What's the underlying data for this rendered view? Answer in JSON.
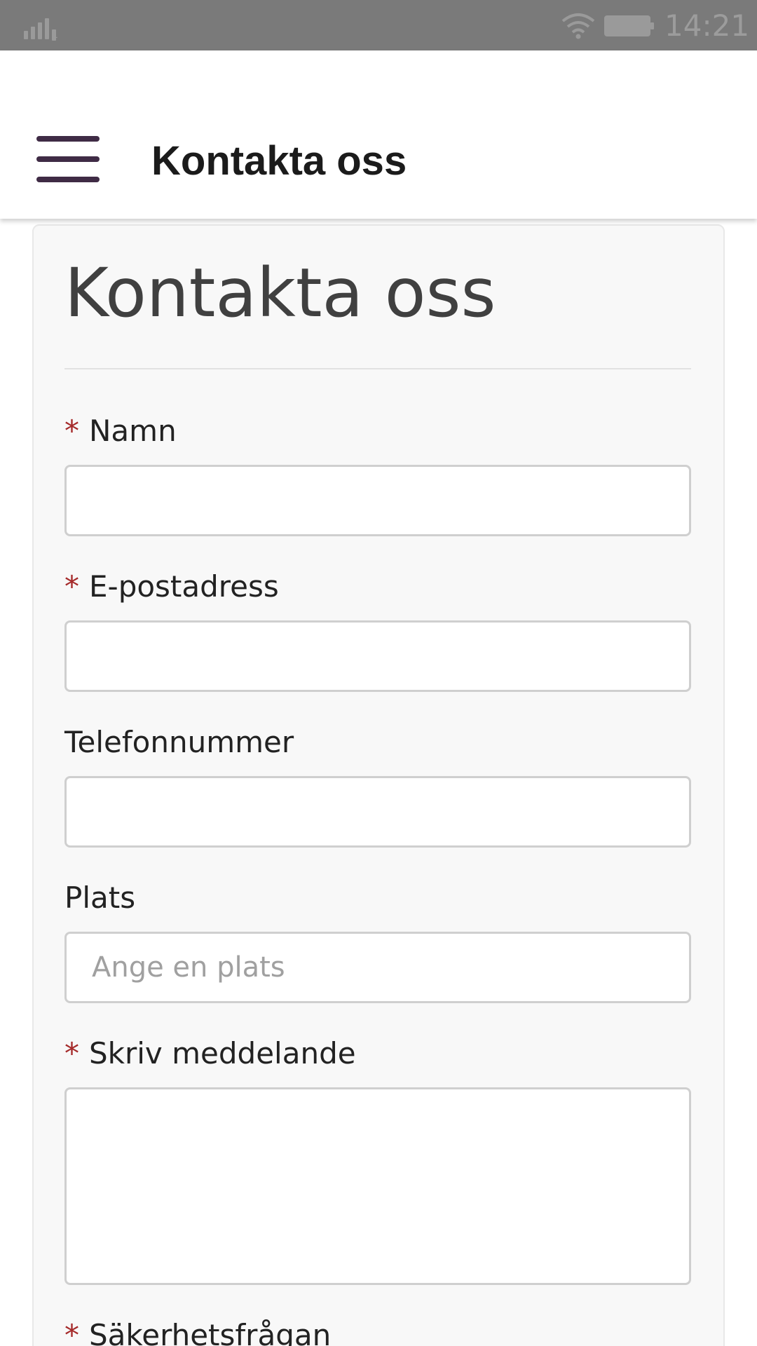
{
  "status_bar": {
    "time": "14:21",
    "signal_sub": "1",
    "icons": [
      "signal-icon",
      "wifi-icon",
      "battery-icon"
    ]
  },
  "app_bar": {
    "menu_icon": "hamburger-menu-icon",
    "title": "Kontakta oss"
  },
  "page": {
    "heading": "Kontakta oss"
  },
  "form": {
    "required_marker": "*",
    "fields": [
      {
        "label": "Namn",
        "required": true,
        "value": "",
        "placeholder": ""
      },
      {
        "label": "E-postadress",
        "required": true,
        "value": "",
        "placeholder": ""
      },
      {
        "label": "Telefonnummer",
        "required": false,
        "value": "",
        "placeholder": ""
      },
      {
        "label": "Plats",
        "required": false,
        "value": "",
        "placeholder": "Ange en plats"
      },
      {
        "label": "Skriv meddelande",
        "required": true,
        "value": "",
        "placeholder": ""
      },
      {
        "label": "Säkerhetsfrågan",
        "required": true
      }
    ]
  },
  "colors": {
    "status_bar": "#7a7a7a",
    "menu_icon": "#3f2b45",
    "required_marker": "#a52a2a",
    "card_background": "#f8f8f8"
  }
}
